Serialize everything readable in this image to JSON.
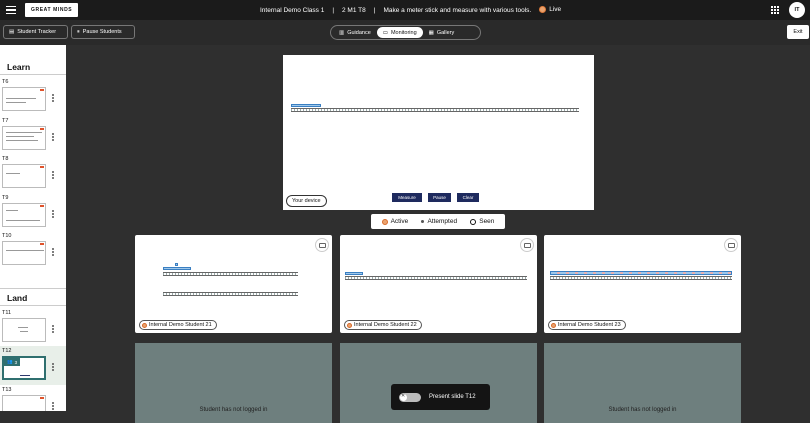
{
  "header": {
    "logo": "GREAT MINDS",
    "class_name": "Internal Demo Class 1",
    "lesson": "2 M1 T8",
    "task": "Make a meter stick and measure with various tools.",
    "live": "Live",
    "avatar_initials": "IT",
    "menu_icon": "hamburger-icon",
    "apps_icon": "grid-icon"
  },
  "toolbar": {
    "student_tracker": "Student Tracker",
    "pause_students": "Pause Students",
    "tabs": [
      {
        "label": "Guidance",
        "icon": "book-icon",
        "active": false
      },
      {
        "label": "Monitoring",
        "icon": "monitor-icon",
        "active": true
      },
      {
        "label": "Gallery",
        "icon": "gallery-icon",
        "active": false
      }
    ],
    "exit": "Exit"
  },
  "sidebar": {
    "sections": [
      {
        "title": "Learn",
        "slides": [
          "T6",
          "T7",
          "T8",
          "T9",
          "T10"
        ]
      },
      {
        "title": "Land",
        "slides": [
          "T11",
          "T12",
          "T13"
        ]
      }
    ],
    "selected_slide": "T12",
    "selected_badge_count": "3"
  },
  "preview": {
    "device_label": "Your device",
    "buttons": [
      "Measure",
      "Pause",
      "Clear"
    ]
  },
  "legend": {
    "active": "Active",
    "attempted": "Attempted",
    "seen": "Seen",
    "active_color": "#e9a36f"
  },
  "students": [
    {
      "name": "Internal Demo Student 21"
    },
    {
      "name": "Internal Demo Student 22"
    },
    {
      "name": "Internal Demo Student 23"
    }
  ],
  "offline_text": "Student has not logged in",
  "present": {
    "label": "Present slide T12",
    "toggle": "✕"
  }
}
